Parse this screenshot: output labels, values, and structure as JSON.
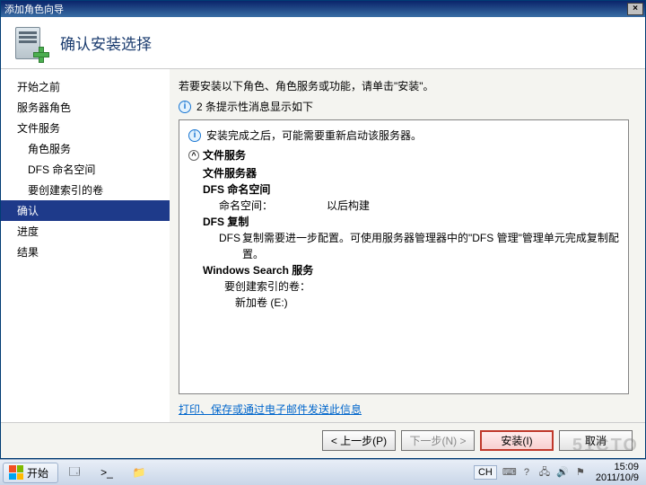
{
  "window": {
    "title": "添加角色向导",
    "close_label": "×"
  },
  "header": {
    "title": "确认安装选择"
  },
  "sidebar": {
    "items": [
      {
        "label": "开始之前"
      },
      {
        "label": "服务器角色"
      },
      {
        "label": "文件服务"
      },
      {
        "label": "角色服务"
      },
      {
        "label": "DFS 命名空间"
      },
      {
        "label": "要创建索引的卷"
      },
      {
        "label": "确认"
      },
      {
        "label": "进度"
      },
      {
        "label": "结果"
      }
    ]
  },
  "main": {
    "instruction": "若要安装以下角色、角色服务或功能，请单击\"安装\"。",
    "info_count": "2 条提示性消息显示如下",
    "restart_note": "安装完成之后，可能需要重新启动该服务器。",
    "section_title": "文件服务",
    "items": {
      "file_server": "文件服务器",
      "dfs_ns": "DFS 命名空间",
      "ns_key": "命名空间：",
      "ns_val": "以后构建",
      "dfs_rep": "DFS 复制",
      "rep_sub": "DFS",
      "rep_note": "复制需要进一步配置。可使用服务器管理器中的\"DFS 管理\"管理单元完成复制配置。",
      "wsearch": "Windows Search 服务",
      "idx_key": "要创建索引的卷：",
      "idx_val": "新加卷 (E:)"
    },
    "print_link": "打印、保存或通过电子邮件发送此信息"
  },
  "buttons": {
    "prev": "< 上一步(P)",
    "next": "下一步(N) >",
    "install": "安装(I)",
    "cancel": "取消"
  },
  "taskbar": {
    "start": "开始",
    "lang": "CH",
    "time": "15:09",
    "date": "2011/10/9"
  }
}
